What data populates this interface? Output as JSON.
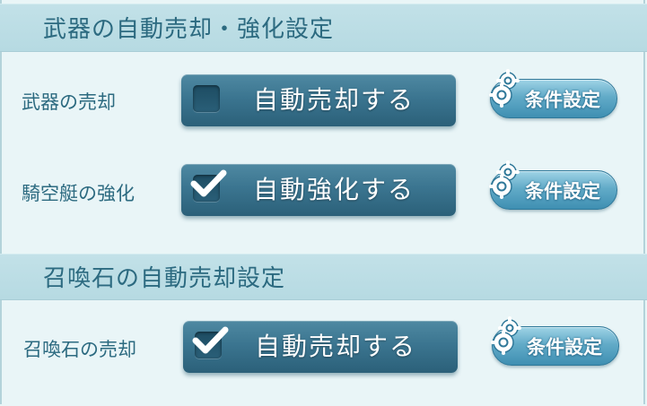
{
  "weapon_section": {
    "title": "武器の自動売却・強化設定",
    "rows": [
      {
        "label": "武器の売却",
        "toggle_label": "自動売却する",
        "checked": false,
        "settings_label": "条件設定"
      },
      {
        "label": "騎空艇の強化",
        "toggle_label": "自動強化する",
        "checked": true,
        "settings_label": "条件設定"
      }
    ]
  },
  "summon_section": {
    "title": "召喚石の自動売却設定",
    "rows": [
      {
        "label": "召喚石の売却",
        "toggle_label": "自動売却する",
        "checked": true,
        "settings_label": "条件設定"
      }
    ]
  },
  "colors": {
    "panel_bg": "#e9f5f7",
    "header_bg": "#b6dae2",
    "text": "#2c6a80",
    "toggle": "#3b7590",
    "settings_button": "#62abc8"
  },
  "icons": {
    "checkbox_checked": "check-icon",
    "checkbox_unchecked": "empty-checkbox",
    "settings": "gear-icon"
  }
}
